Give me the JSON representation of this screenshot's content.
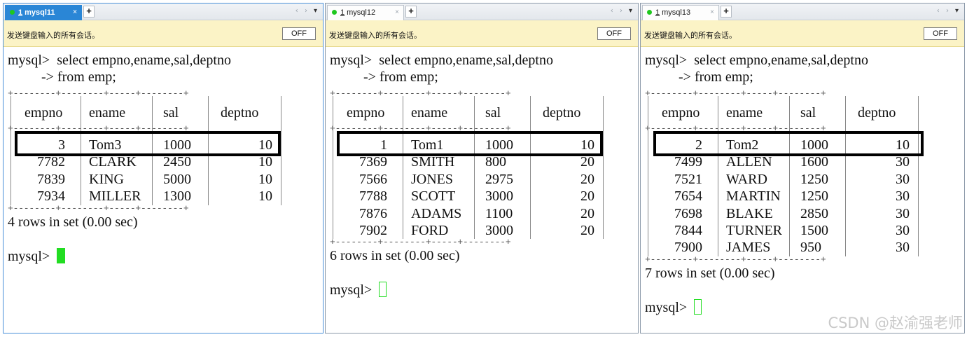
{
  "watermark": "CSDN @赵渝强老师",
  "icons": {
    "plus": "+",
    "tab_close": "×",
    "nav": "‹ ›",
    "dropdown": "▾"
  },
  "panes": [
    {
      "tab": {
        "num": "1",
        "name": "mysql11",
        "active": true
      },
      "notice": "发送键盘输入的所有会话。",
      "off_label": "OFF",
      "prompt": "mysql>",
      "query_line1": "select empno,ename,sal,deptno",
      "query_line2": "-> from emp;",
      "columns": [
        "empno",
        "ename",
        "sal",
        "deptno"
      ],
      "rows": [
        [
          "3",
          "Tom3",
          "1000",
          "10"
        ],
        [
          "7782",
          "CLARK",
          "2450",
          "10"
        ],
        [
          "7839",
          "KING",
          "5000",
          "10"
        ],
        [
          "7934",
          "MILLER",
          "1300",
          "10"
        ]
      ],
      "result": "4 rows in set (0.00 sec)",
      "final_prompt": "mysql>",
      "cursor": "solid"
    },
    {
      "tab": {
        "num": "1",
        "name": "mysql12",
        "active": false
      },
      "notice": "发送键盘输入的所有会话。",
      "off_label": "OFF",
      "prompt": "mysql>",
      "query_line1": "select empno,ename,sal,deptno",
      "query_line2": "-> from emp;",
      "columns": [
        "empno",
        "ename",
        "sal",
        "deptno"
      ],
      "rows": [
        [
          "1",
          "Tom1",
          "1000",
          "10"
        ],
        [
          "7369",
          "SMITH",
          "800",
          "20"
        ],
        [
          "7566",
          "JONES",
          "2975",
          "20"
        ],
        [
          "7788",
          "SCOTT",
          "3000",
          "20"
        ],
        [
          "7876",
          "ADAMS",
          "1100",
          "20"
        ],
        [
          "7902",
          "FORD",
          "3000",
          "20"
        ]
      ],
      "result": "6 rows in set (0.00 sec)",
      "final_prompt": "mysql>",
      "cursor": "hollow"
    },
    {
      "tab": {
        "num": "1",
        "name": "mysql13",
        "active": false
      },
      "notice": "发送键盘输入的所有会话。",
      "off_label": "OFF",
      "prompt": "mysql>",
      "query_line1": "select empno,ename,sal,deptno",
      "query_line2": "-> from emp;",
      "columns": [
        "empno",
        "ename",
        "sal",
        "deptno"
      ],
      "rows": [
        [
          "2",
          "Tom2",
          "1000",
          "10"
        ],
        [
          "7499",
          "ALLEN",
          "1600",
          "30"
        ],
        [
          "7521",
          "WARD",
          "1250",
          "30"
        ],
        [
          "7654",
          "MARTIN",
          "1250",
          "30"
        ],
        [
          "7698",
          "BLAKE",
          "2850",
          "30"
        ],
        [
          "7844",
          "TURNER",
          "1500",
          "30"
        ],
        [
          "7900",
          "JAMES",
          "950",
          "30"
        ]
      ],
      "result": "7 rows in set (0.00 sec)",
      "final_prompt": "mysql>",
      "cursor": "hollow"
    }
  ]
}
